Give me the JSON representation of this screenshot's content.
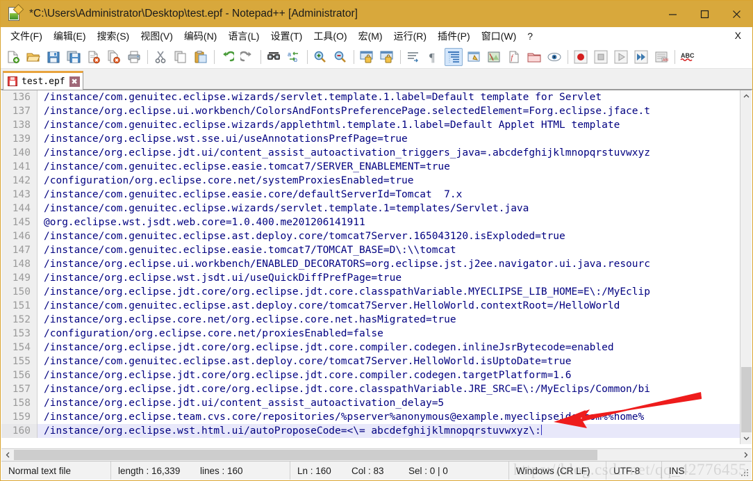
{
  "window": {
    "title": "*C:\\Users\\Administrator\\Desktop\\test.epf - Notepad++ [Administrator]",
    "icon": "notepad-plus-plus-icon",
    "minimize_label": "—",
    "maximize_label": "□",
    "close_label": "✕",
    "titlebar_color": "#d8a83c"
  },
  "menubar": {
    "items": [
      {
        "label": "文件(F)",
        "name": "menu-file"
      },
      {
        "label": "编辑(E)",
        "name": "menu-edit"
      },
      {
        "label": "搜索(S)",
        "name": "menu-search"
      },
      {
        "label": "视图(V)",
        "name": "menu-view"
      },
      {
        "label": "编码(N)",
        "name": "menu-encoding"
      },
      {
        "label": "语言(L)",
        "name": "menu-language"
      },
      {
        "label": "设置(T)",
        "name": "menu-settings"
      },
      {
        "label": "工具(O)",
        "name": "menu-tools"
      },
      {
        "label": "宏(M)",
        "name": "menu-macro"
      },
      {
        "label": "运行(R)",
        "name": "menu-run"
      },
      {
        "label": "插件(P)",
        "name": "menu-plugins"
      },
      {
        "label": "窗口(W)",
        "name": "menu-window"
      },
      {
        "label": "?",
        "name": "menu-help"
      }
    ],
    "close_doc_label": "X"
  },
  "toolbar": {
    "buttons": [
      {
        "name": "new-file-icon",
        "tip": "新建"
      },
      {
        "name": "open-file-icon",
        "tip": "打开"
      },
      {
        "name": "save-icon",
        "tip": "保存"
      },
      {
        "name": "save-all-icon",
        "tip": "全部保存"
      },
      {
        "name": "close-file-icon",
        "tip": "关闭"
      },
      {
        "name": "close-all-files-icon",
        "tip": "全部关闭"
      },
      {
        "name": "print-icon",
        "tip": "打印"
      },
      {
        "name": "separator-1",
        "tip": ""
      },
      {
        "name": "cut-icon",
        "tip": "剪切"
      },
      {
        "name": "copy-icon",
        "tip": "复制"
      },
      {
        "name": "paste-icon",
        "tip": "粘贴"
      },
      {
        "name": "separator-2",
        "tip": ""
      },
      {
        "name": "undo-icon",
        "tip": "撤销"
      },
      {
        "name": "redo-icon",
        "tip": "重做"
      },
      {
        "name": "separator-3",
        "tip": ""
      },
      {
        "name": "find-icon",
        "tip": "查找"
      },
      {
        "name": "replace-icon",
        "tip": "替换"
      },
      {
        "name": "separator-4",
        "tip": ""
      },
      {
        "name": "zoom-in-icon",
        "tip": "放大"
      },
      {
        "name": "zoom-out-icon",
        "tip": "缩小"
      },
      {
        "name": "separator-5",
        "tip": ""
      },
      {
        "name": "sync-vertical-scroll-icon",
        "tip": "同步垂直滚动"
      },
      {
        "name": "sync-horizontal-scroll-icon",
        "tip": "同步水平滚动"
      },
      {
        "name": "separator-6",
        "tip": ""
      },
      {
        "name": "word-wrap-icon",
        "tip": "自动换行"
      },
      {
        "name": "show-all-characters-icon",
        "tip": "显示所有字符"
      },
      {
        "name": "indent-guide-icon",
        "tip": "显示缩进参考线"
      },
      {
        "name": "user-defined-language-icon",
        "tip": "用户自定义语言"
      },
      {
        "name": "document-map-icon",
        "tip": "文档地图"
      },
      {
        "name": "function-list-icon",
        "tip": "函数列表"
      },
      {
        "name": "folder-as-workspace-icon",
        "tip": "打开文件夹为工作区"
      },
      {
        "name": "monitoring-icon",
        "tip": "监视"
      },
      {
        "name": "separator-7",
        "tip": ""
      },
      {
        "name": "record-macro-icon",
        "tip": "开始录制宏"
      },
      {
        "name": "stop-macro-icon",
        "tip": "停止录制宏"
      },
      {
        "name": "play-macro-icon",
        "tip": "播放"
      },
      {
        "name": "run-macro-multiple-icon",
        "tip": "多次运行宏"
      },
      {
        "name": "save-macro-icon",
        "tip": "保存当前录制的宏"
      },
      {
        "name": "separator-8",
        "tip": ""
      },
      {
        "name": "spell-check-icon",
        "tip": "ABC 拼写检查"
      }
    ],
    "active_button": "word-wrap-icon"
  },
  "tabs": [
    {
      "label": "test.epf",
      "name": "tab-test-epf",
      "modified": true,
      "active": true,
      "close_label": "✖"
    }
  ],
  "editor": {
    "first_line_number": 136,
    "selected_line": 160,
    "lines": [
      {
        "n": "136",
        "text": "/instance/com.genuitec.eclipse.wizards/servlet.template.1.label=Default template for Servlet"
      },
      {
        "n": "137",
        "text": "/instance/org.eclipse.ui.workbench/ColorsAndFontsPreferencePage.selectedElement=Forg.eclipse.jface.t"
      },
      {
        "n": "138",
        "text": "/instance/com.genuitec.eclipse.wizards/applethtml.template.1.label=Default Applet HTML template"
      },
      {
        "n": "139",
        "text": "/instance/org.eclipse.wst.sse.ui/useAnnotationsPrefPage=true"
      },
      {
        "n": "140",
        "text": "/instance/org.eclipse.jdt.ui/content_assist_autoactivation_triggers_java=.abcdefghijklmnopqrstuvwxyz"
      },
      {
        "n": "141",
        "text": "/instance/com.genuitec.eclipse.easie.tomcat7/SERVER_ENABLEMENT=true"
      },
      {
        "n": "142",
        "text": "/configuration/org.eclipse.core.net/systemProxiesEnabled=true"
      },
      {
        "n": "143",
        "text": "/instance/com.genuitec.eclipse.easie.core/defaultServerId=Tomcat  7.x"
      },
      {
        "n": "144",
        "text": "/instance/com.genuitec.eclipse.wizards/servlet.template.1=templates/Servlet.java"
      },
      {
        "n": "145",
        "text": "@org.eclipse.wst.jsdt.web.core=1.0.400.me201206141911"
      },
      {
        "n": "146",
        "text": "/instance/com.genuitec.eclipse.ast.deploy.core/tomcat7Server.165043120.isExploded=true"
      },
      {
        "n": "147",
        "text": "/instance/com.genuitec.eclipse.easie.tomcat7/TOMCAT_BASE=D\\:\\\\tomcat"
      },
      {
        "n": "148",
        "text": "/instance/org.eclipse.ui.workbench/ENABLED_DECORATORS=org.eclipse.jst.j2ee.navigator.ui.java.resourc"
      },
      {
        "n": "149",
        "text": "/instance/org.eclipse.wst.jsdt.ui/useQuickDiffPrefPage=true"
      },
      {
        "n": "150",
        "text": "/instance/org.eclipse.jdt.core/org.eclipse.jdt.core.classpathVariable.MYECLIPSE_LIB_HOME=E\\:/MyEclip"
      },
      {
        "n": "151",
        "text": "/instance/com.genuitec.eclipse.ast.deploy.core/tomcat7Server.HelloWorld.contextRoot=/HelloWorld"
      },
      {
        "n": "152",
        "text": "/instance/org.eclipse.core.net/org.eclipse.core.net.hasMigrated=true"
      },
      {
        "n": "153",
        "text": "/configuration/org.eclipse.core.net/proxiesEnabled=false"
      },
      {
        "n": "154",
        "text": "/instance/org.eclipse.jdt.core/org.eclipse.jdt.core.compiler.codegen.inlineJsrBytecode=enabled"
      },
      {
        "n": "155",
        "text": "/instance/com.genuitec.eclipse.ast.deploy.core/tomcat7Server.HelloWorld.isUptoDate=true"
      },
      {
        "n": "156",
        "text": "/instance/org.eclipse.jdt.core/org.eclipse.jdt.core.compiler.codegen.targetPlatform=1.6"
      },
      {
        "n": "157",
        "text": "/instance/org.eclipse.jdt.core/org.eclipse.jdt.core.classpathVariable.JRE_SRC=E\\:/MyEclips/Common/bi"
      },
      {
        "n": "158",
        "text": "/instance/org.eclipse.jdt.ui/content_assist_autoactivation_delay=5"
      },
      {
        "n": "159",
        "text": "/instance/org.eclipse.team.cvs.core/repositories/%pserver%anonymous@example.myeclipseide.com%%home%"
      },
      {
        "n": "160",
        "text": "/instance/org.eclipse.wst.html.ui/autoProposeCode=<\\= abcdefghijklmnopqrstuvwxyz\\:"
      }
    ],
    "text_color": "#000080",
    "selection_color": "#e8e8fa"
  },
  "statusbar": {
    "file_type": "Normal text file",
    "length": "length : 16,339",
    "lines": "lines : 160",
    "ln": "Ln : 160",
    "col": "Col : 83",
    "sel": "Sel : 0 | 0",
    "eol": "Windows (CR LF)",
    "encoding": "UTF-8",
    "insert_mode": "INS"
  },
  "watermark": "https://blog.csdn.net/qq_42776455",
  "annotation": {
    "type": "red-arrow",
    "color": "#ee1c1c"
  }
}
